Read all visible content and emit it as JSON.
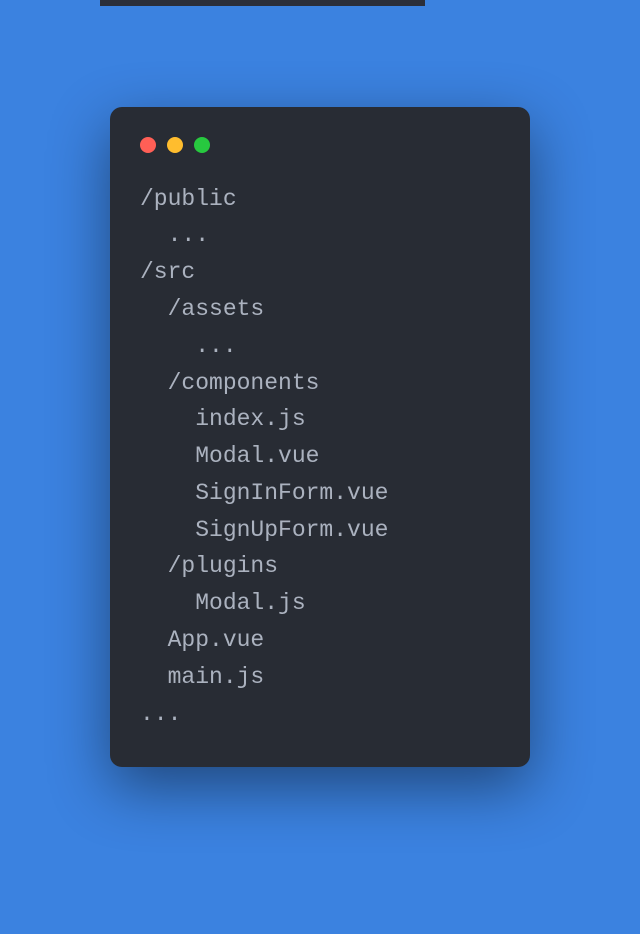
{
  "lines": [
    "/public",
    "  ...",
    "/src",
    "  /assets",
    "    ...",
    "  /components",
    "    index.js",
    "    Modal.vue",
    "    SignInForm.vue",
    "    SignUpForm.vue",
    "  /plugins",
    "    Modal.js",
    "  App.vue",
    "  main.js",
    "..."
  ]
}
